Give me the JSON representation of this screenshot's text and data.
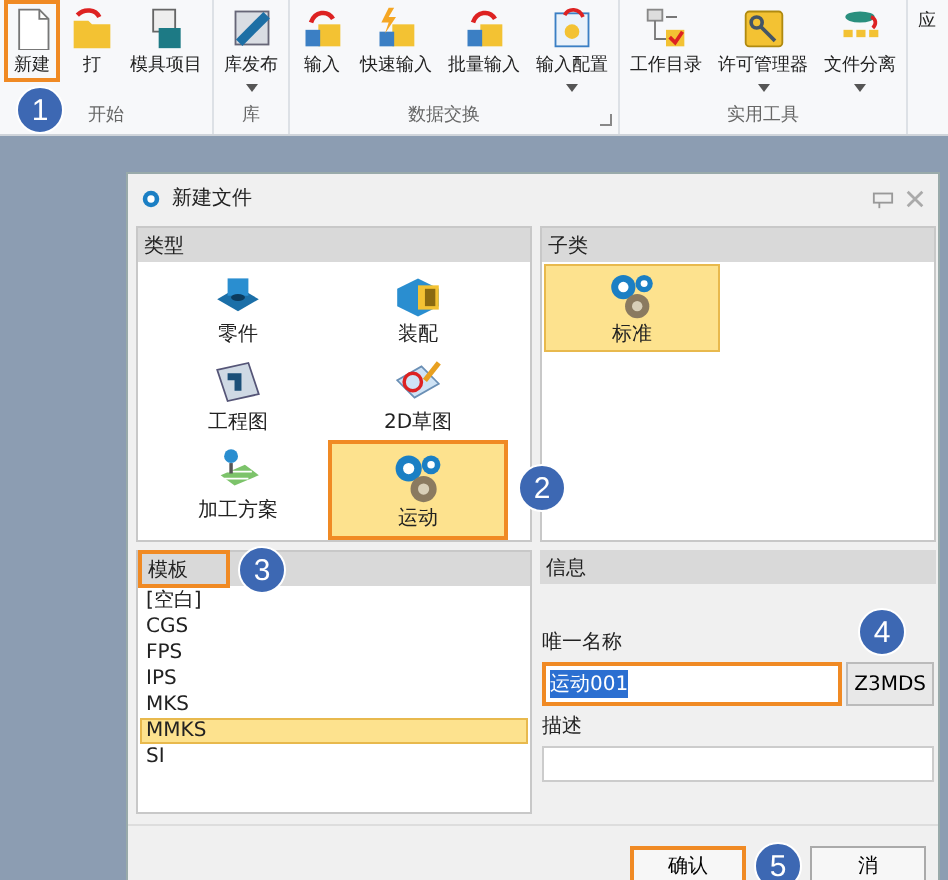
{
  "ribbon": {
    "groups": [
      {
        "label": "开始",
        "buttons": [
          {
            "label": "新建",
            "highlighted": true,
            "callout": "1"
          },
          {
            "label": "打",
            "highlighted": false
          },
          {
            "label": "模具项目",
            "highlighted": false
          }
        ]
      },
      {
        "label": "库",
        "buttons": [
          {
            "label": "库发布",
            "dropdown": true,
            "highlighted": false
          }
        ]
      },
      {
        "label": "数据交换",
        "launcher": true,
        "buttons": [
          {
            "label": "输入",
            "highlighted": false
          },
          {
            "label": "快速输入",
            "highlighted": false
          },
          {
            "label": "批量输入",
            "highlighted": false
          },
          {
            "label": "输入配置",
            "dropdown": true,
            "highlighted": false
          }
        ]
      },
      {
        "label": "实用工具",
        "buttons": [
          {
            "label": "工作目录",
            "highlighted": false
          },
          {
            "label": "许可管理器",
            "dropdown": true,
            "highlighted": false
          },
          {
            "label": "文件分离",
            "dropdown": true,
            "highlighted": false
          }
        ]
      },
      {
        "buttons": [
          {
            "label": "应",
            "highlighted": false
          }
        ]
      }
    ]
  },
  "dialog": {
    "title": "新建文件",
    "type_panel": {
      "header": "类型",
      "items": [
        {
          "label": "零件",
          "selected": false,
          "highlighted": false
        },
        {
          "label": "装配",
          "selected": false,
          "highlighted": false
        },
        {
          "label": "工程图",
          "selected": false,
          "highlighted": false
        },
        {
          "label": "2D草图",
          "selected": false,
          "highlighted": false
        },
        {
          "label": "加工方案",
          "selected": false,
          "highlighted": false
        },
        {
          "label": "运动",
          "selected": true,
          "highlighted": true,
          "callout": "2"
        }
      ]
    },
    "subtype_panel": {
      "header": "子类",
      "items": [
        {
          "label": "标准",
          "selected": true
        }
      ]
    },
    "template_panel": {
      "header": "模板",
      "highlighted": true,
      "callout": "3",
      "items": [
        {
          "label": "[空白]",
          "selected": false
        },
        {
          "label": "CGS",
          "selected": false
        },
        {
          "label": "FPS",
          "selected": false
        },
        {
          "label": "IPS",
          "selected": false
        },
        {
          "label": "MKS",
          "selected": false
        },
        {
          "label": "MMKS",
          "selected": true
        },
        {
          "label": "SI",
          "selected": false
        }
      ]
    },
    "info_panel": {
      "header": "信息",
      "name_label": "唯一名称",
      "name_value": "运动001",
      "name_highlighted": true,
      "name_callout": "4",
      "z3_button": "Z3MDS",
      "description_label": "描述"
    },
    "buttons": [
      {
        "label": "确认",
        "highlighted": true,
        "callout": "5"
      },
      {
        "label": "消",
        "highlighted": false
      }
    ]
  }
}
